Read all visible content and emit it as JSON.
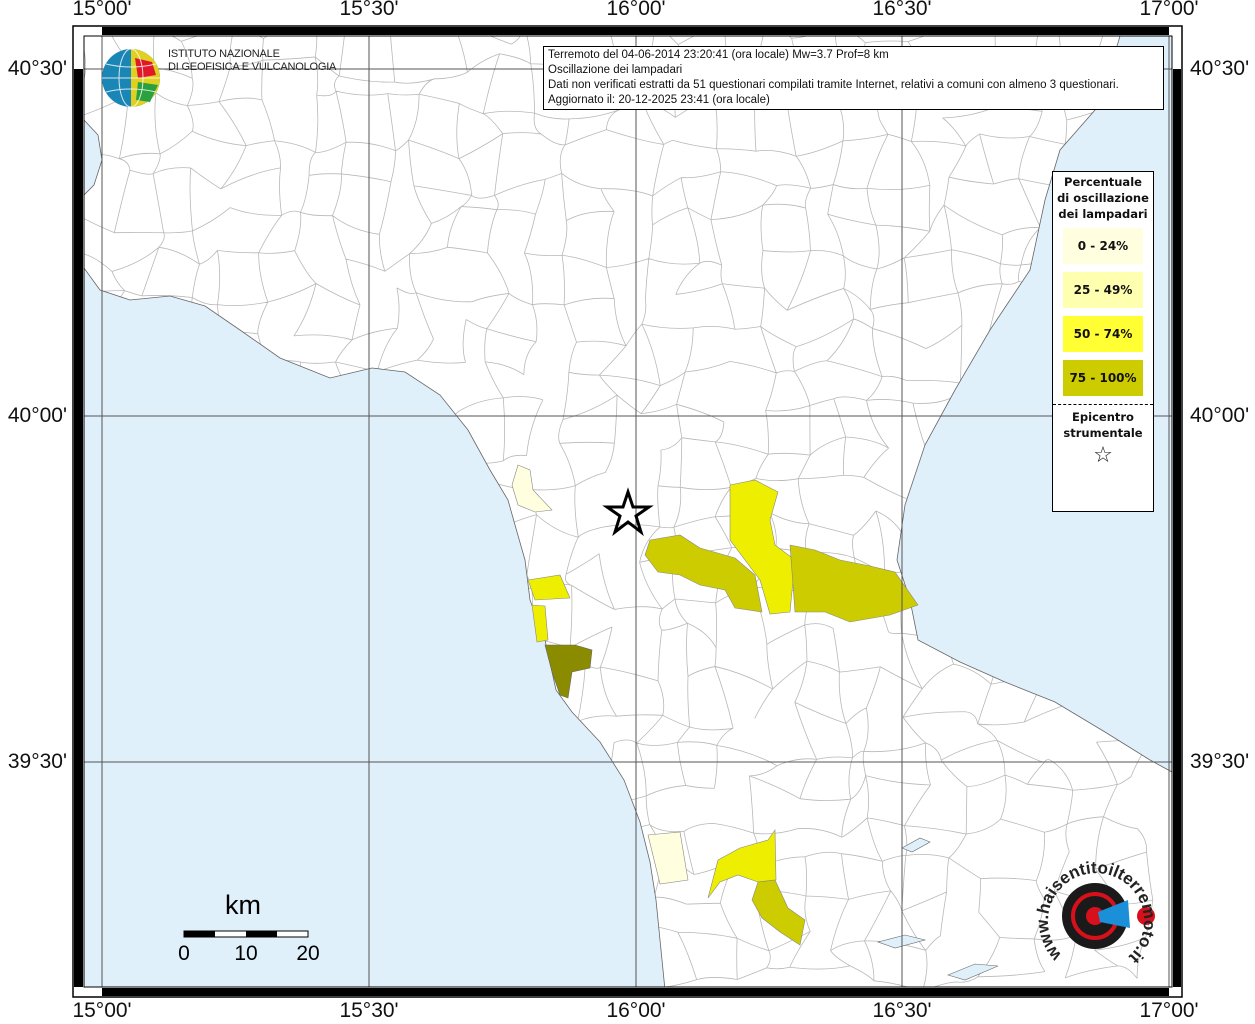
{
  "title_box": {
    "line1": "Terremoto del 04-06-2014 23:20:41 (ora locale) Mw=3.7 Prof=8 km",
    "line2": "Oscillazione dei lampadari",
    "line3": "Dati non verificati estratti da 51 questionari compilati tramite Internet, relativi a comuni con almeno 3 questionari.",
    "line4": "Aggiornato il: 20-12-2025 23:41 (ora locale)"
  },
  "axes": {
    "lon_labels": [
      "15°00'",
      "15°30'",
      "16°00'",
      "16°30'",
      "17°00'"
    ],
    "lat_labels": [
      "40°30'",
      "40°00'",
      "39°30'"
    ]
  },
  "logo": {
    "line1": "ISTITUTO NAZIONALE",
    "line2": "DI GEOFISICA E VULCANOLOGIA"
  },
  "legend": {
    "title": "Percentuale di oscillazione dei lampadari",
    "classes": [
      {
        "label": "0 - 24%",
        "color": "#ffffe0"
      },
      {
        "label": "25 - 49%",
        "color": "#ffffb0"
      },
      {
        "label": "50 - 74%",
        "color": "#ffff33"
      },
      {
        "label": "75 - 100%",
        "color": "#cccc00"
      }
    ],
    "epicenter_label": "Epicentro strumentale",
    "epicenter_symbol": "☆"
  },
  "scale_bar": {
    "unit": "km",
    "labels": [
      "0",
      "10",
      "20"
    ]
  },
  "badge": {
    "text": "www.haisentitoilterremoto.it"
  },
  "colors": {
    "sea": "#e0f0fb",
    "land": "#ffffff",
    "boundary": "#b0b0b0",
    "grid": "#555555",
    "class4_dark": "#8b8b00"
  }
}
